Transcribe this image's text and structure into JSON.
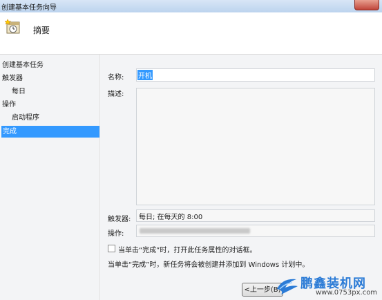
{
  "window": {
    "title": "创建基本任务向导"
  },
  "header": {
    "title": "摘要",
    "icon": "clock-task-icon"
  },
  "sidebar": {
    "items": [
      {
        "label": "创建基本任务"
      },
      {
        "label": "触发器"
      },
      {
        "label": "每日"
      },
      {
        "label": "操作"
      },
      {
        "label": "启动程序"
      },
      {
        "label": "完成"
      }
    ]
  },
  "form": {
    "name_label": "名称:",
    "name_value": "开机",
    "description_label": "描述:",
    "trigger_label": "触发器:",
    "trigger_value": "每日; 在每天的 8:00",
    "action_label": "操作:",
    "open_properties_label": "当单击“完成”时，打开此任务属性的对话框。",
    "info_text": "当单击“完成”时，新任务将会被创建并添加到 Windows 计划中。"
  },
  "buttons": {
    "back_label": "<上一步(B)"
  },
  "watermark": {
    "brand": "鹏鑫装机网",
    "url": "www.0753px.com"
  },
  "colors": {
    "selection": "#3399ff",
    "title_gradient_top": "#d8e6f6",
    "panel_bg": "#f3f4f6"
  }
}
